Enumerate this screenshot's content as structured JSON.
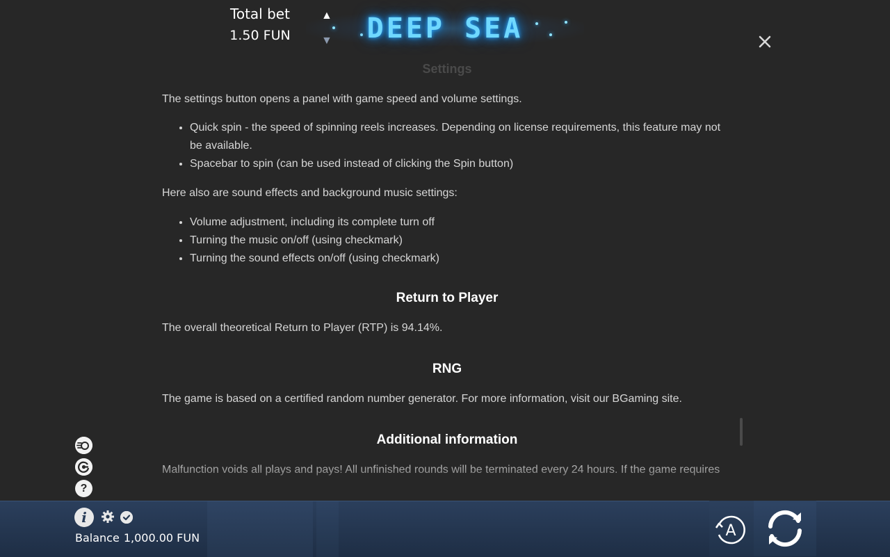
{
  "header": {
    "logo_text": "DEEP SEA",
    "close_icon": "close-icon"
  },
  "content": {
    "faded_heading": "Settings",
    "settings_intro": "The settings button opens a panel with game speed and volume settings.",
    "settings_items": [
      "Quick spin - the speed of spinning reels increases. Depending on license requirements, this feature may not be available.",
      "Spacebar to spin (can be used instead of clicking the Spin button)"
    ],
    "sound_intro": "Here also are sound effects and background music settings:",
    "sound_items": [
      "Volume adjustment, including its complete turn off",
      "Turning the music on/off (using checkmark)",
      "Turning the sound effects on/off (using checkmark)"
    ],
    "rtp_heading": "Return to Player",
    "rtp_text": "The overall theoretical Return to Player (RTP) is 94.14%.",
    "rng_heading": "RNG",
    "rng_text": "The game is based on a certified random number generator. For more information, visit our BGaming site.",
    "additional_heading": "Additional information",
    "additional_text": "Malfunction voids all plays and pays! All unfinished rounds will be terminated every 24 hours. If the game requires"
  },
  "side_icons": {
    "sound_icon": "sound-coin-icon",
    "history_icon": "history-icon",
    "help_icon": "?"
  },
  "bottom_bar": {
    "info_label": "i",
    "total_bet_label": "Total bet",
    "total_bet_value": "1.50 FUN",
    "balance_label": "Balance",
    "balance_value": "1,000.00 FUN",
    "auto_label": "A",
    "arrow_up": "▲",
    "arrow_down": "▼"
  }
}
